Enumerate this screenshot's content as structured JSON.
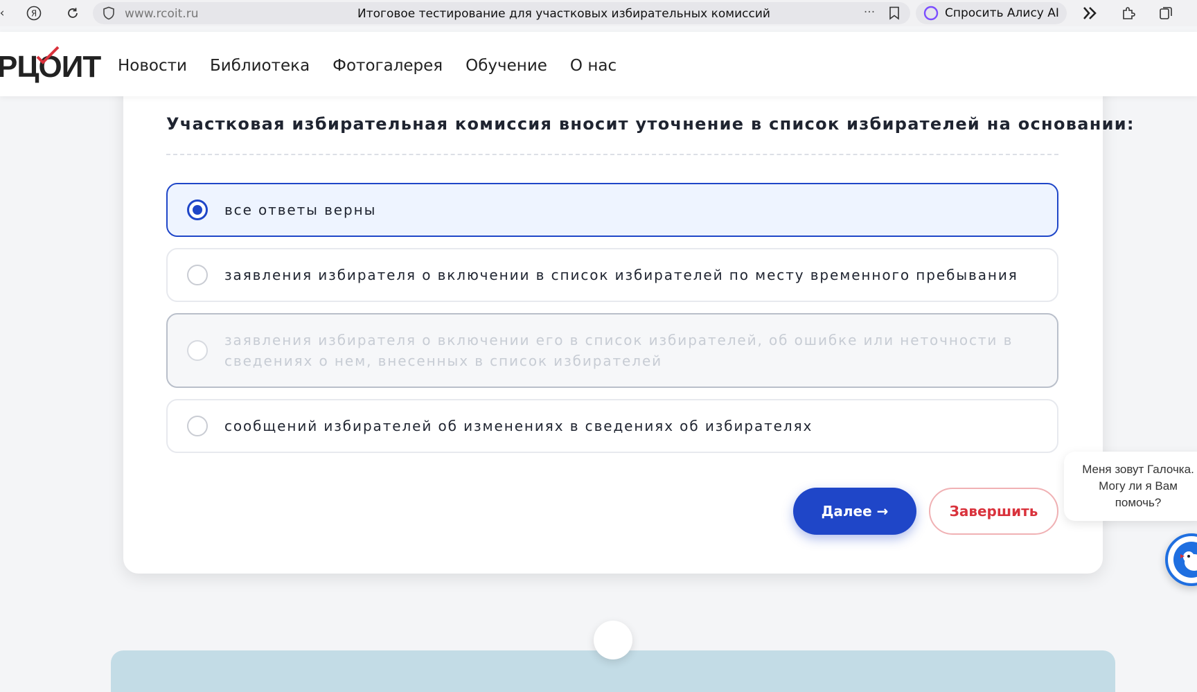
{
  "browser": {
    "url": "www.rcoit.ru",
    "tab_title": "Итоговое тестирование для участковых избирательных комиссий",
    "alice_label": "Спросить Алису AI",
    "more_glyph": "···"
  },
  "site": {
    "logo_text": "РЦОИТ",
    "nav": [
      {
        "label": "Новости"
      },
      {
        "label": "Библиотека"
      },
      {
        "label": "Фотогалерея"
      },
      {
        "label": "Обучение"
      },
      {
        "label": "О нас"
      }
    ]
  },
  "quiz": {
    "question": "Участковая избирательная комиссия вносит уточнение в список избирателей на основании:",
    "options": [
      {
        "text": "все ответы верны",
        "state": "selected"
      },
      {
        "text": "заявления избирателя о включении в список избирателей по месту временного пребывания",
        "state": "normal"
      },
      {
        "text": "заявления избирателя о включении его в список избирателей, об ошибке или неточности в сведениях о нем, внесенных в список избирателей",
        "state": "disabled"
      },
      {
        "text": "сообщений избирателей об изменениях в сведениях об избирателях",
        "state": "normal"
      }
    ],
    "next_label": "Далее →",
    "finish_label": "Завершить"
  },
  "chat": {
    "message": "Меня зовут Галочка. Могу ли я Вам помочь?"
  },
  "colors": {
    "accent": "#1f46c8",
    "danger": "#d9323c",
    "logo_check": "#d9323c"
  }
}
